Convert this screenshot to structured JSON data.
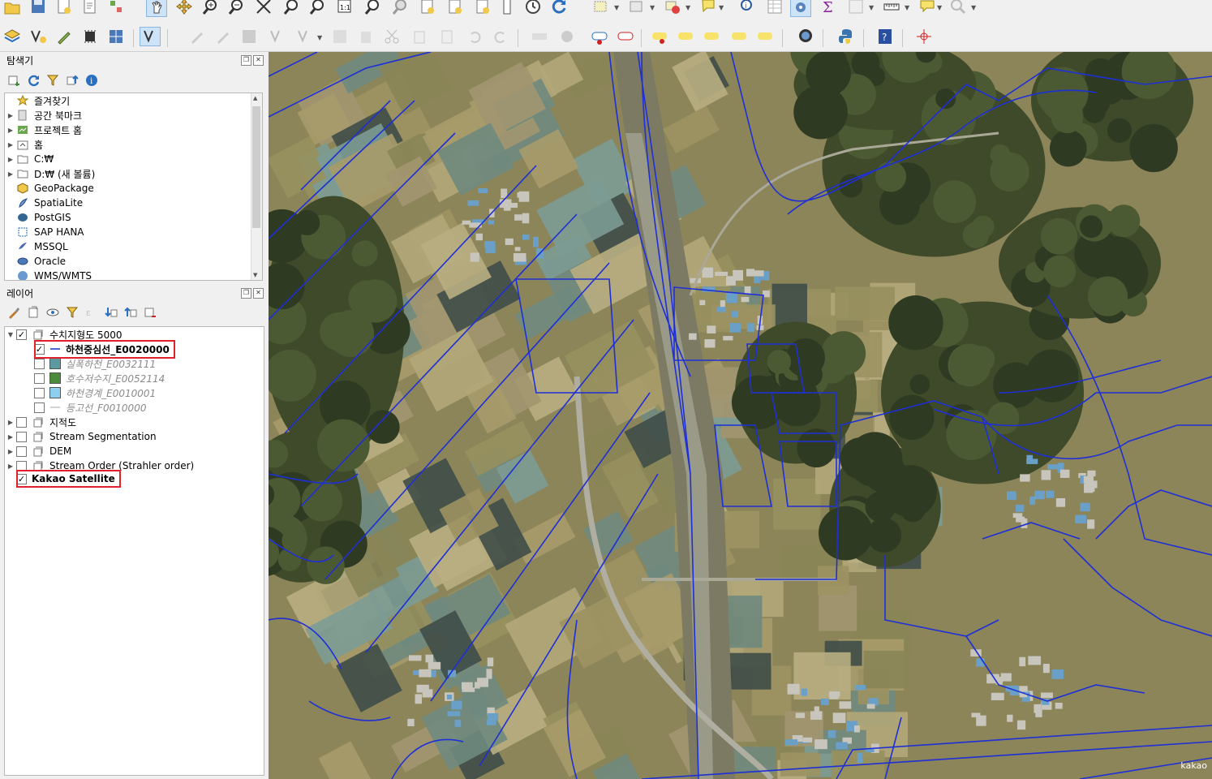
{
  "browser_panel": {
    "title": "탐색기",
    "items": [
      {
        "label": "즐겨찾기",
        "icon": "star-icon",
        "expand": false
      },
      {
        "label": "공간 북마크",
        "icon": "bookmark-icon",
        "expand": true
      },
      {
        "label": "프로젝트 홈",
        "icon": "project-home-icon",
        "expand": true
      },
      {
        "label": "홈",
        "icon": "home-folder-icon",
        "expand": true
      },
      {
        "label": "C:₩",
        "icon": "folder-icon",
        "expand": true
      },
      {
        "label": "D:₩ (새 볼륨)",
        "icon": "folder-icon",
        "expand": true
      },
      {
        "label": "GeoPackage",
        "icon": "geopackage-icon",
        "expand": false
      },
      {
        "label": "SpatiaLite",
        "icon": "spatialite-icon",
        "expand": false
      },
      {
        "label": "PostGIS",
        "icon": "postgis-icon",
        "expand": false
      },
      {
        "label": "SAP HANA",
        "icon": "saphana-icon",
        "expand": false
      },
      {
        "label": "MSSQL",
        "icon": "mssql-icon",
        "expand": false
      },
      {
        "label": "Oracle",
        "icon": "oracle-icon",
        "expand": false
      },
      {
        "label": "WMS/WMTS",
        "icon": "wms-icon",
        "expand": false
      }
    ]
  },
  "layers_panel": {
    "title": "레이어",
    "group": {
      "label": "수치지형도 5000",
      "checked": true
    },
    "children": [
      {
        "label": "하천중심선_E0020000",
        "checked": true,
        "symbol": "line",
        "color": "#1f3fd0",
        "bold": true,
        "dim": false
      },
      {
        "label": "실폭하천_E0032111",
        "checked": false,
        "symbol": "fill",
        "color": "#5b9aa0",
        "bold": false,
        "dim": true
      },
      {
        "label": "호수저수지_E0052114",
        "checked": false,
        "symbol": "fill",
        "color": "#4b8b3b",
        "bold": false,
        "dim": true
      },
      {
        "label": "하천경계_E0010001",
        "checked": false,
        "symbol": "fill",
        "color": "#8ecff0",
        "bold": false,
        "dim": true
      },
      {
        "label": "등고선_F0010000",
        "checked": false,
        "symbol": "line",
        "color": "#c8c8c8",
        "bold": false,
        "dim": true
      }
    ],
    "groups": [
      {
        "label": "지적도",
        "checked": false
      },
      {
        "label": "Stream Segmentation",
        "checked": false
      },
      {
        "label": "DEM",
        "checked": false
      },
      {
        "label": "Stream Order (Strahler order)",
        "checked": false
      }
    ],
    "basemap": {
      "label": "Kakao Satellite",
      "checked": true
    }
  },
  "map": {
    "attribution": "kakao",
    "stream_color": "#1e2fd6"
  },
  "colors": {
    "highlight": "#e0202a"
  }
}
